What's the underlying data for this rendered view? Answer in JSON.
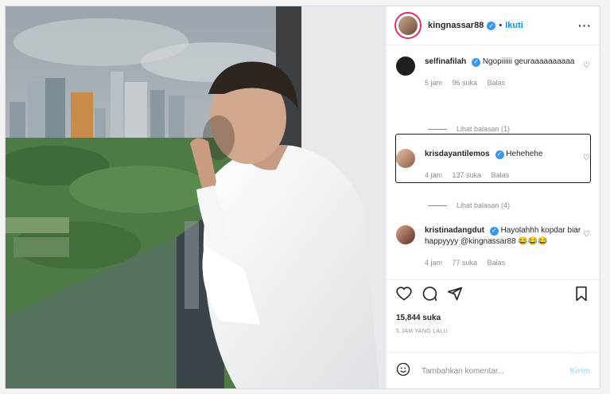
{
  "header": {
    "username": "kingnassar88",
    "separator": "•",
    "follow_label": "Ikuti",
    "more_label": "···"
  },
  "comments": [
    {
      "username": "selfinafilah",
      "text": "Ngopiiiiii geuraaaaaaaaaa",
      "time": "5 jam",
      "likes": "96 suka",
      "reply_label": "Balas",
      "view_replies": "Lihat balasan (1)"
    },
    {
      "username": "krisdayantilemos",
      "text": "Hehehehe",
      "time": "4 jam",
      "likes": "137 suka",
      "reply_label": "Balas",
      "view_replies": "Lihat balasan (4)"
    },
    {
      "username": "kristinadangdut",
      "text": "Hayolahhh kopdar biar happyyyy @kingnassar88 😂😂😂",
      "time": "4 jam",
      "likes": "77 suka",
      "reply_label": "Balas"
    }
  ],
  "actions": {
    "likes": "15,844 suka",
    "posted": "5 JAM YANG LALU"
  },
  "add_comment": {
    "placeholder": "Tambahkan komentar...",
    "post_label": "Kirim"
  },
  "colors": {
    "link": "#0095f6",
    "verified": "#3897f0",
    "muted": "#8e8e8e"
  },
  "icons": [
    "verified-icon",
    "more-icon",
    "heart-icon",
    "comment-icon",
    "share-icon",
    "bookmark-icon",
    "emoji-icon"
  ]
}
